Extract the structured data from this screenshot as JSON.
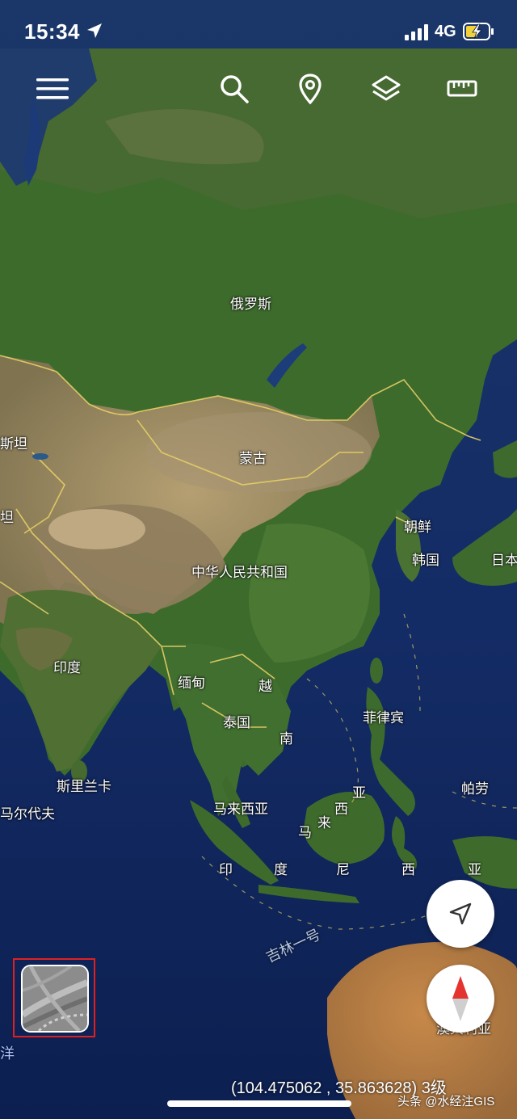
{
  "status_bar": {
    "time": "15:34",
    "network": "4G",
    "icons": [
      "location-arrow-icon",
      "signal-bars-icon",
      "battery-charging-icon"
    ]
  },
  "toolbar": {
    "icons": [
      "menu-icon",
      "search-icon",
      "map-pin-icon",
      "layers-icon",
      "ruler-icon"
    ]
  },
  "map": {
    "labels": {
      "russia": "俄罗斯",
      "mongolia": "蒙古",
      "china": "中华人民共和国",
      "north_korea": "朝鲜",
      "south_korea": "韩国",
      "japan": "日本",
      "kazakhstan_fragment": "斯坦",
      "tajik_fragment": "坦",
      "india": "印度",
      "myanmar": "缅甸",
      "vietnam_1": "越",
      "vietnam_2": "南",
      "thailand": "泰国",
      "philippines": "菲律宾",
      "sri_lanka": "斯里兰卡",
      "maldives": "马尔代夫",
      "palau": "帕劳",
      "malaysia_peninsula": "马来西亚",
      "malaysia_borneo": [
        "亚",
        "西",
        "来",
        "马"
      ],
      "indonesia": [
        "印",
        "度",
        "尼",
        "西",
        "亚"
      ],
      "australia": "澳大利亚",
      "jilin_1": "吉林一号",
      "edge_char": "洋"
    },
    "colors": {
      "ocean": "#10285e",
      "border": "#e8d266",
      "forest": "#3c6a2c",
      "desert": "#a58f64"
    }
  },
  "controls": {
    "locate_icon": "navigation-arrow-icon",
    "compass_icon": "compass-needle-icon",
    "layer_switch_icon": "satellite-layer-thumbnail"
  },
  "footer": {
    "coordinates": "(104.475062 , 35.863628) 3级",
    "watermark": "头条 @水经注GIS"
  }
}
